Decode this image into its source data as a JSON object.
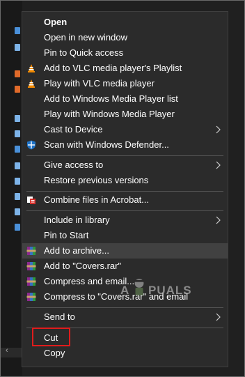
{
  "menu": {
    "items": [
      {
        "label": "Open"
      },
      {
        "label": "Open in new window"
      },
      {
        "label": "Pin to Quick access"
      },
      {
        "label": "Add to VLC media player's Playlist"
      },
      {
        "label": "Play with VLC media player"
      },
      {
        "label": "Add to Windows Media Player list"
      },
      {
        "label": "Play with Windows Media Player"
      },
      {
        "label": "Cast to Device"
      },
      {
        "label": "Scan with Windows Defender..."
      },
      {
        "label": "Give access to"
      },
      {
        "label": "Restore previous versions"
      },
      {
        "label": "Combine files in Acrobat..."
      },
      {
        "label": "Include in library"
      },
      {
        "label": "Pin to Start"
      },
      {
        "label": "Add to archive..."
      },
      {
        "label": "Add to \"Covers.rar\""
      },
      {
        "label": "Compress and email..."
      },
      {
        "label": "Compress to \"Covers.rar\" and email"
      },
      {
        "label": "Send to"
      },
      {
        "label": "Cut"
      },
      {
        "label": "Copy"
      }
    ]
  },
  "watermark": {
    "text_left": "A",
    "text_right": "PUALS"
  },
  "colors": {
    "menu_bg": "#2b2b2b",
    "hover_bg": "#414141",
    "separator": "#555555",
    "highlight_box": "#e01c1c",
    "vlc_orange": "#f28a00",
    "defender_blue": "#1e73c8",
    "acrobat_red": "#d9302c"
  },
  "icons": {
    "vlc": "vlc-cone-icon",
    "defender": "windows-defender-shield-icon",
    "acrobat": "acrobat-combine-icon",
    "winrar": "winrar-books-icon",
    "submenu": "chevron-right-icon"
  }
}
